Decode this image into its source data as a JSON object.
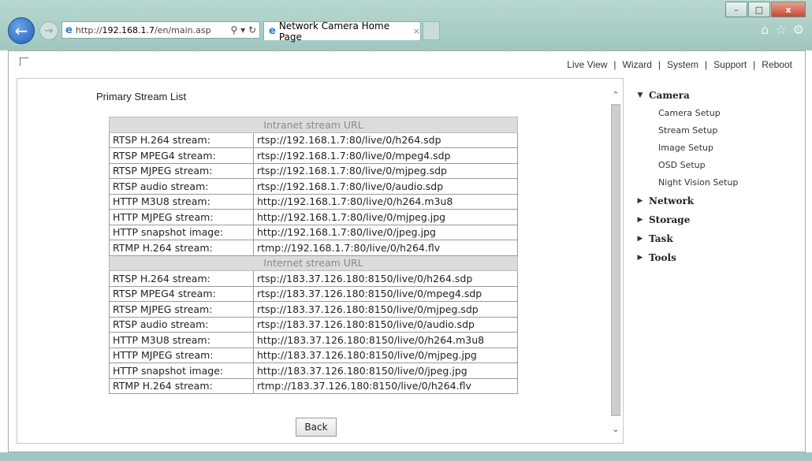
{
  "browser": {
    "url_prefix": "http://",
    "url_host": "192.168.1.7",
    "url_path": "/en/main.asp",
    "search_icon": "search-icon",
    "refresh_icon": "refresh-icon",
    "tab_title": "Network Camera Home Page",
    "tab_close": "×",
    "win_minimize": "–",
    "win_maximize": "□",
    "win_close": "x",
    "home_icon": "home-icon",
    "favorites_icon": "star-icon",
    "tools_icon": "gear-icon"
  },
  "topnav": {
    "live_view": "Live View",
    "wizard": "Wizard",
    "system": "System",
    "support": "Support",
    "reboot": "Reboot",
    "separator": "|"
  },
  "panel": {
    "title": "Primary Stream List",
    "intranet_header": "Intranet stream URL",
    "internet_header": "Internet stream URL",
    "intranet_rows": [
      {
        "label": "RTSP H.264 stream:",
        "url": "rtsp://192.168.1.7:80/live/0/h264.sdp"
      },
      {
        "label": "RTSP MPEG4 stream:",
        "url": "rtsp://192.168.1.7:80/live/0/mpeg4.sdp"
      },
      {
        "label": "RTSP MJPEG stream:",
        "url": "rtsp://192.168.1.7:80/live/0/mjpeg.sdp"
      },
      {
        "label": "RTSP audio stream:",
        "url": "rtsp://192.168.1.7:80/live/0/audio.sdp"
      },
      {
        "label": "HTTP M3U8 stream:",
        "url": "http://192.168.1.7:80/live/0/h264.m3u8"
      },
      {
        "label": "HTTP MJPEG stream:",
        "url": "http://192.168.1.7:80/live/0/mjpeg.jpg"
      },
      {
        "label": "HTTP snapshot image:",
        "url": "http://192.168.1.7:80/live/0/jpeg.jpg"
      },
      {
        "label": "RTMP H.264 stream:",
        "url": "rtmp://192.168.1.7:80/live/0/h264.flv"
      }
    ],
    "internet_rows": [
      {
        "label": "RTSP H.264 stream:",
        "url": "rtsp://183.37.126.180:8150/live/0/h264.sdp"
      },
      {
        "label": "RTSP MPEG4 stream:",
        "url": "rtsp://183.37.126.180:8150/live/0/mpeg4.sdp"
      },
      {
        "label": "RTSP MJPEG stream:",
        "url": "rtsp://183.37.126.180:8150/live/0/mjpeg.sdp"
      },
      {
        "label": "RTSP audio stream:",
        "url": "rtsp://183.37.126.180:8150/live/0/audio.sdp"
      },
      {
        "label": "HTTP M3U8 stream:",
        "url": "http://183.37.126.180:8150/live/0/h264.m3u8"
      },
      {
        "label": "HTTP MJPEG stream:",
        "url": "http://183.37.126.180:8150/live/0/mjpeg.jpg"
      },
      {
        "label": "HTTP snapshot image:",
        "url": "http://183.37.126.180:8150/live/0/jpeg.jpg"
      },
      {
        "label": "RTMP H.264 stream:",
        "url": "rtmp://183.37.126.180:8150/live/0/h264.flv"
      }
    ],
    "back_label": "Back"
  },
  "sidebar": {
    "camera": "Camera",
    "camera_items": [
      "Camera Setup",
      "Stream Setup",
      "Image Setup",
      "OSD Setup",
      "Night Vision Setup"
    ],
    "network": "Network",
    "storage": "Storage",
    "task": "Task",
    "tools": "Tools",
    "expanded_arrow": "▼",
    "collapsed_arrow": "▶"
  }
}
